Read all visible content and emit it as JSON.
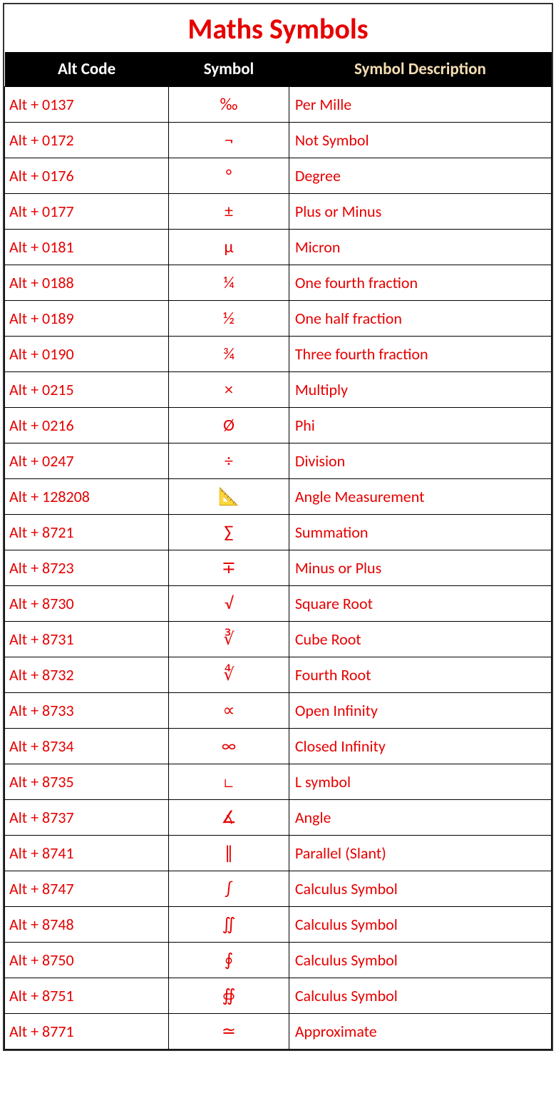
{
  "title": "Maths Symbols",
  "headers": {
    "col1": "Alt Code",
    "col2": "Symbol",
    "col3": "Symbol Description"
  },
  "rows": [
    {
      "code": "Alt + 0137",
      "symbol": "‰",
      "desc": "Per Mille"
    },
    {
      "code": "Alt + 0172",
      "symbol": "¬",
      "desc": "Not Symbol"
    },
    {
      "code": "Alt + 0176",
      "symbol": "°",
      "desc": "Degree"
    },
    {
      "code": "Alt + 0177",
      "symbol": "±",
      "desc": "Plus or Minus"
    },
    {
      "code": "Alt + 0181",
      "symbol": "µ",
      "desc": "Micron"
    },
    {
      "code": "Alt + 0188",
      "symbol": "¼",
      "desc": "One fourth fraction"
    },
    {
      "code": "Alt + 0189",
      "symbol": "½",
      "desc": "One half fraction"
    },
    {
      "code": "Alt + 0190",
      "symbol": "¾",
      "desc": "Three fourth fraction"
    },
    {
      "code": "Alt + 0215",
      "symbol": "×",
      "desc": "Multiply"
    },
    {
      "code": "Alt + 0216",
      "symbol": "Ø",
      "desc": "Phi"
    },
    {
      "code": "Alt + 0247",
      "symbol": "÷",
      "desc": "Division"
    },
    {
      "code": "Alt + 128208",
      "symbol": "📐",
      "desc": "Angle Measurement"
    },
    {
      "code": "Alt + 8721",
      "symbol": "∑",
      "desc": "Summation"
    },
    {
      "code": "Alt + 8723",
      "symbol": "∓",
      "desc": "Minus or Plus"
    },
    {
      "code": "Alt + 8730",
      "symbol": "√",
      "desc": "Square Root"
    },
    {
      "code": "Alt + 8731",
      "symbol": "∛",
      "desc": "Cube Root"
    },
    {
      "code": "Alt + 8732",
      "symbol": "∜",
      "desc": "Fourth Root"
    },
    {
      "code": "Alt + 8733",
      "symbol": "∝",
      "desc": "Open Infinity"
    },
    {
      "code": "Alt + 8734",
      "symbol": "∞",
      "desc": "Closed Infinity"
    },
    {
      "code": "Alt + 8735",
      "symbol": "∟",
      "desc": "L symbol"
    },
    {
      "code": "Alt + 8737",
      "symbol": "∡",
      "desc": "Angle"
    },
    {
      "code": "Alt + 8741",
      "symbol": "∥",
      "desc": "Parallel (Slant)"
    },
    {
      "code": "Alt + 8747",
      "symbol": "∫",
      "desc": "Calculus Symbol"
    },
    {
      "code": "Alt + 8748",
      "symbol": "∬",
      "desc": "Calculus Symbol"
    },
    {
      "code": "Alt + 8750",
      "symbol": "∮",
      "desc": "Calculus Symbol"
    },
    {
      "code": "Alt + 8751",
      "symbol": "∯",
      "desc": "Calculus Symbol"
    },
    {
      "code": "Alt + 8771",
      "symbol": "≃",
      "desc": "Approximate"
    }
  ]
}
